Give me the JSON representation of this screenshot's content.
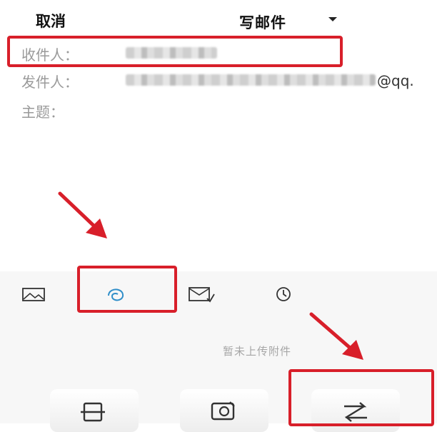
{
  "header": {
    "cancel_label": "取消",
    "title": "写邮件",
    "title_dropdown_icon": "caret-down-icon"
  },
  "fields": {
    "to_label": "收件人：",
    "from_label": "发件人：",
    "from_suffix": "@qq.",
    "subject_label": "主题："
  },
  "toolbar": {
    "icons": [
      "image-icon",
      "attachment-icon",
      "postcard-icon",
      "clock-icon"
    ]
  },
  "attachments": {
    "empty_text": "暂未上传附件"
  },
  "bottom_actions": {
    "icons": [
      "scan-document-icon",
      "photo-icon",
      "transfer-icon"
    ]
  },
  "colors": {
    "highlight": "#d81f2a",
    "accent": "#2f8ec9"
  }
}
